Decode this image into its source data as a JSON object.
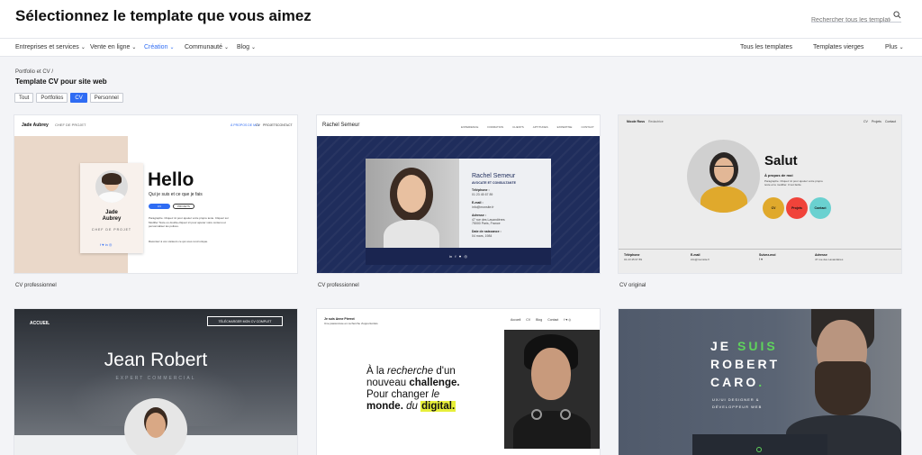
{
  "header": {
    "title": "Sélectionnez le template que vous aimez",
    "search_placeholder": "Rechercher tous les templates..."
  },
  "nav": {
    "left": [
      "Entreprises et services",
      "Vente en ligne",
      "Création",
      "Communauté",
      "Blog"
    ],
    "right": [
      "Tous les templates",
      "Templates vierges",
      "Plus"
    ]
  },
  "breadcrumb": "Portfolio et CV /",
  "section_title": "Template CV pour site web",
  "filters": [
    "Tout",
    "Portfolios",
    "CV",
    "Personnel"
  ],
  "cards": [
    {
      "caption": "CV professionnel",
      "brand": "Jade Aubrey",
      "brand_sub": "CHEF DE PROJET",
      "nav": [
        "À PROPOS DE MOI",
        "CV",
        "PROJETS",
        "CONTACT"
      ],
      "name_line1": "Jade",
      "name_line2": "Aubrey",
      "role": "CHEF DE PROJET",
      "headline": "Hello",
      "subline": "Qui je suis et ce que je fais",
      "btn_primary": "CV",
      "btn_secondary": "PROJETS",
      "para": "Paragraphe. Cliquez ici pour ajouter votre propre texte. Cliquez sur Modifier Texte ou double-cliquez ici pour ajouter votre contenu et personnaliser les polices.",
      "para2": "Racontez à vos visiteurs ce qui vous rend unique."
    },
    {
      "caption": "CV professionnel",
      "brand": "Rachel Semeur",
      "nav": [
        "EXPERIENCE",
        "FORMATION",
        "CLIENTS",
        "APTITUDES",
        "EXPERTISE",
        "CONTACT"
      ],
      "name": "Rachel Semeur",
      "role": "AVOCATE ET CONSULTANTE",
      "phone_label": "Téléphone :",
      "phone": "01 23 45 67 89",
      "email_label": "E-mail :",
      "email": "info@monsite.fr",
      "address_label": "Adresse :",
      "address1": "47 rue des Lavandières",
      "address2": "75000 Paris, France",
      "birth_label": "Date de naissance :",
      "birth": "04 mars, 1984"
    },
    {
      "caption": "CV original",
      "brand": "Nicole Ross",
      "brand_sub": "Redactrice",
      "nav": [
        "CV",
        "Projets",
        "Contact"
      ],
      "headline": "Salut",
      "about_title": "À propos de moi",
      "about_text": "Paragraphe. Cliquez ici pour ajouter votre propre texte et le modifier. C'est facile.",
      "circles": [
        "CV",
        "Projets",
        "Contact"
      ],
      "footer": [
        "Téléphone",
        "E-mail",
        "Suivez-moi",
        "Adresse"
      ],
      "footer_values": [
        "01 23 45 67 89",
        "info@monsite.fr",
        "",
        "47 rue des Lavandières"
      ]
    },
    {
      "caption": "",
      "menu": "ACCUEIL",
      "cta": "TÉLÉCHARGER MON CV COMPLET",
      "name": "Jean Robert",
      "role": "EXPERT COMMERCIAL"
    },
    {
      "caption": "",
      "brand": "Je suis Anne Pierrot",
      "brand_sub": "Une passionnée en recherche d'opportunités",
      "nav": [
        "Accueil",
        "CV",
        "Blog",
        "Contact"
      ],
      "line1a": "À la ",
      "line1b": "recherche",
      "line1c": " d'un",
      "line2a": "nouveau ",
      "line2b": "challenge.",
      "line3a": "Pour changer ",
      "line3b": "le",
      "line4a": "monde. ",
      "line4b": "du ",
      "line4c": "digital."
    },
    {
      "caption": "",
      "line1a": "JE ",
      "line1b": "SUIS",
      "line2": "ROBERT",
      "line3a": "CARO",
      "line3b": ".",
      "role1": "UX/UI DESIGNER &",
      "role2": "DÉVELOPPEUR WEB"
    }
  ],
  "colors": {
    "accent": "#2f6cf3",
    "navy": "#1f2d5c",
    "green": "#5fd35c",
    "yellow": "#e7ef3a"
  }
}
